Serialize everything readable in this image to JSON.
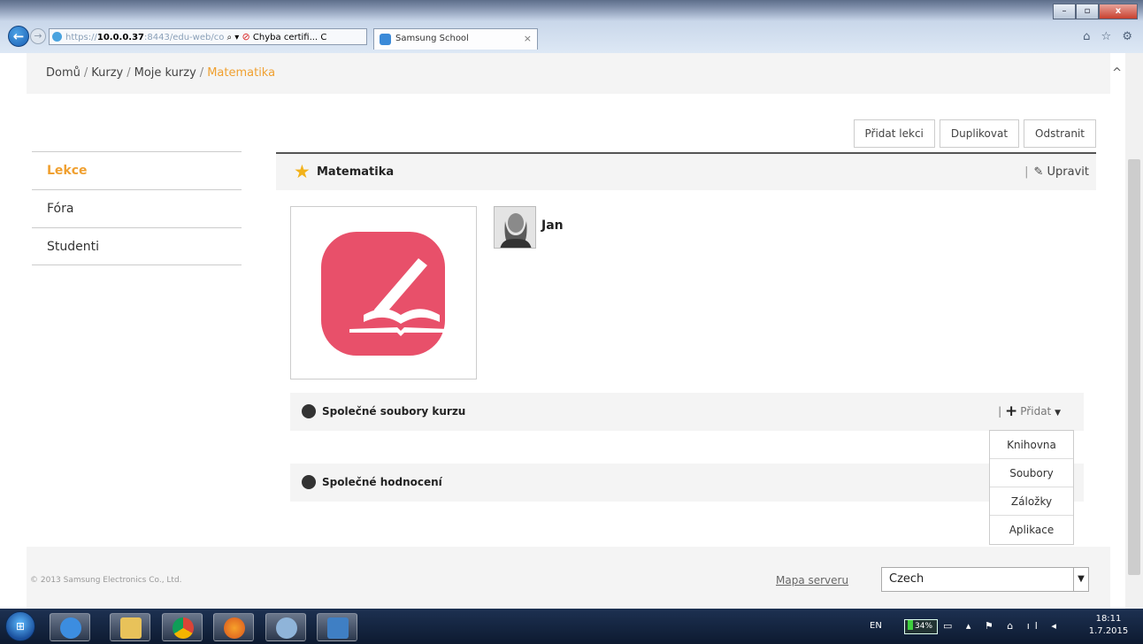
{
  "browser": {
    "address": {
      "prefix": "https://",
      "host": "10.0.0.37",
      "port_path": ":8443/edu-web/co",
      "search_glyph": "⌕ ▾",
      "cert_label": "Chyba certifi...",
      "refresh_glyph": "C"
    },
    "tab": {
      "title": "Samsung School",
      "close_glyph": "×"
    },
    "window_controls": {
      "minimize": "–",
      "maximize": "▫",
      "close": "x"
    },
    "chrome_icons": "⌂ ☆ ⚙"
  },
  "breadcrumb": {
    "items": [
      "Domů",
      "Kurzy",
      "Moje kurzy"
    ],
    "separator": "/",
    "current": "Matematika"
  },
  "toolbar": {
    "add_lesson": "Přidat lekci",
    "duplicate": "Duplikovat",
    "delete": "Odstranit"
  },
  "sidebar": {
    "items": [
      {
        "label": "Lekce"
      },
      {
        "label": "Fóra"
      },
      {
        "label": "Studenti"
      }
    ]
  },
  "course": {
    "title": "Matematika",
    "edit_label": "Upravit",
    "edit_separator": "|",
    "teacher": "Jan"
  },
  "sections": {
    "files": {
      "title": "Společné soubory kurzu",
      "add_label": "Přidat",
      "separator": "|"
    },
    "evaluation": {
      "title": "Společné hodnocení"
    }
  },
  "add_menu": {
    "items": [
      "Knihovna",
      "Soubory",
      "Záložky",
      "Aplikace"
    ]
  },
  "footer": {
    "copyright": "© 2013 Samsung Electronics Co., Ltd.",
    "sitemap": "Mapa serveru",
    "language": "Czech"
  },
  "taskbar": {
    "lang": "EN",
    "battery": "34%",
    "battery_level": 0.34,
    "tray_icons": "▭ ▴ ⚑ ⌂ ıl ◂",
    "time": "18:11",
    "date": "1.7.2015"
  },
  "colors": {
    "accent": "#f0a030",
    "course_icon": "#e8506a",
    "star": "#f2b21b"
  }
}
